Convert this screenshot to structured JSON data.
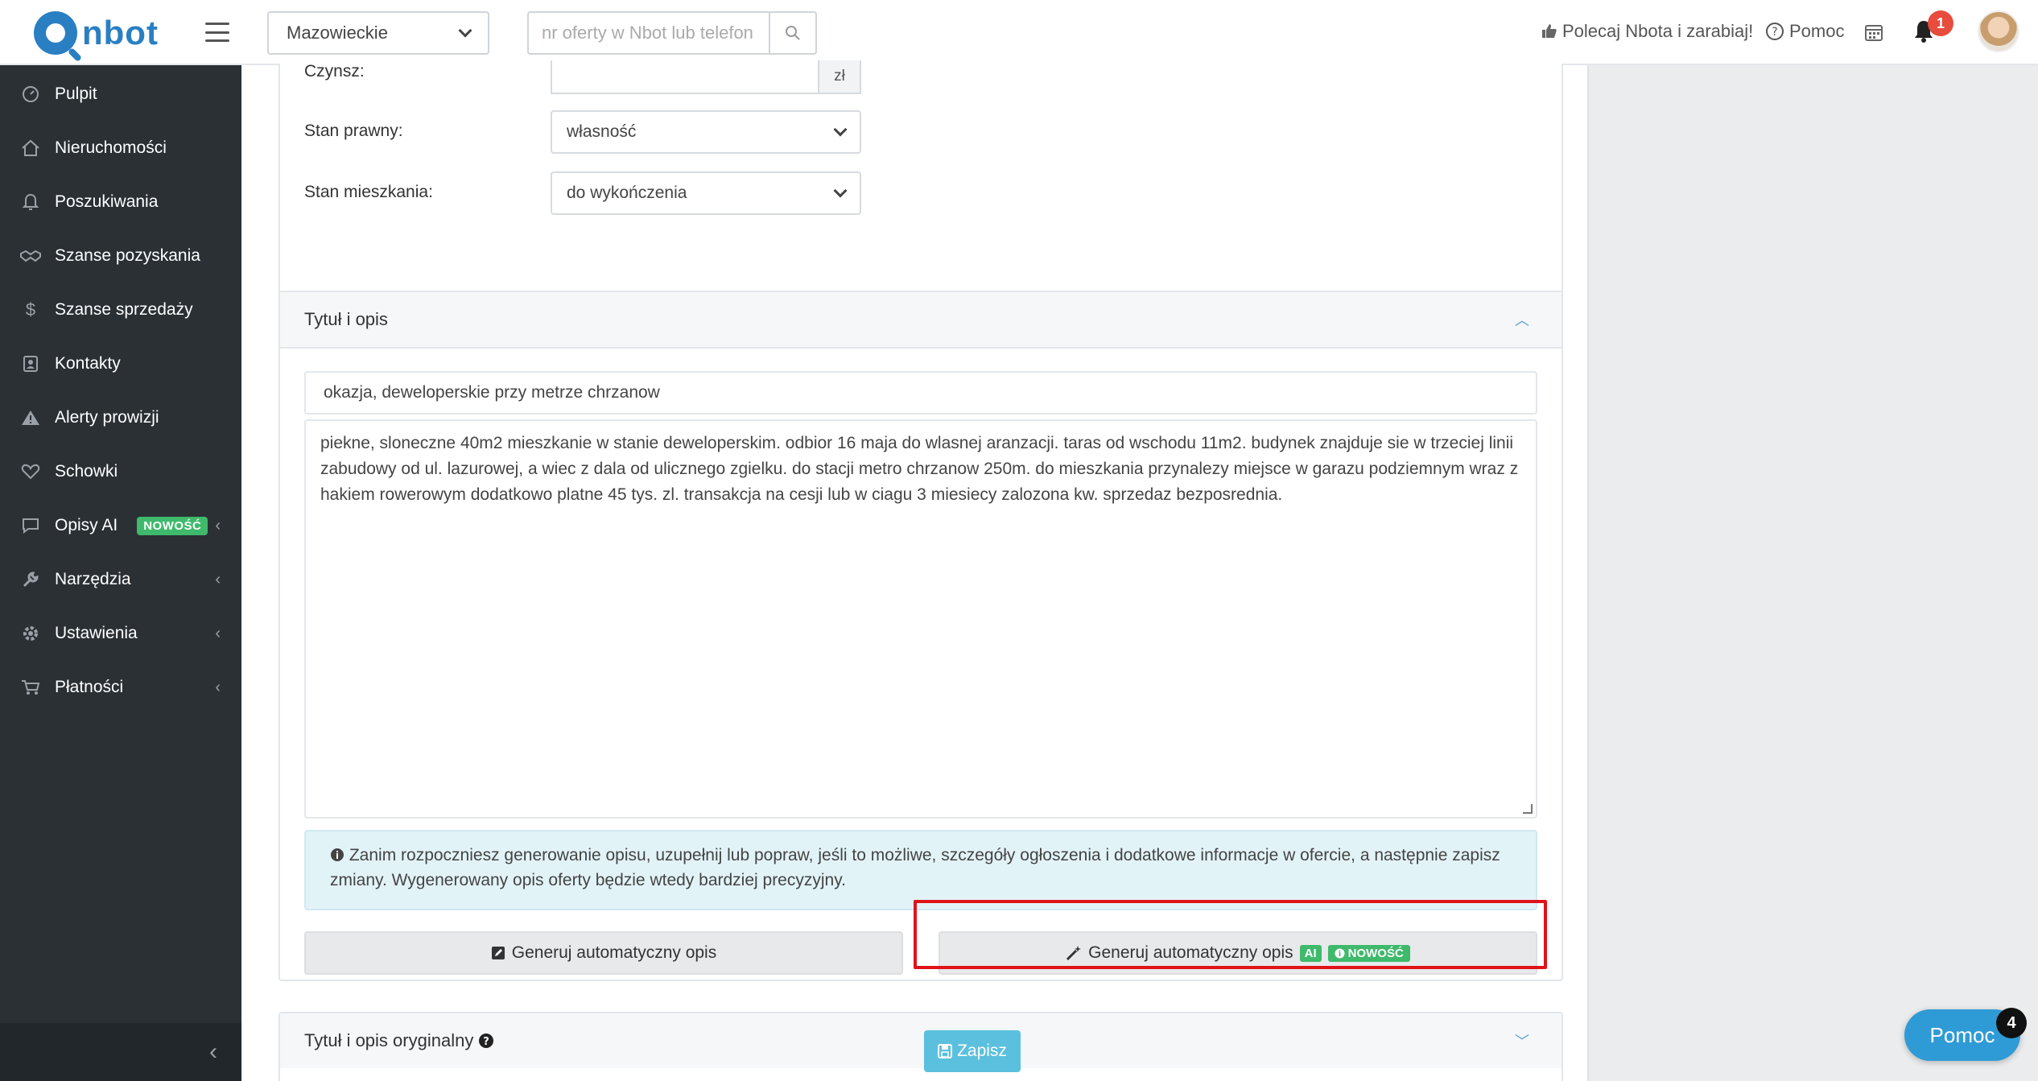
{
  "app": {
    "logo_text": "nbot"
  },
  "navbar": {
    "region": "Mazowieckie",
    "search_placeholder": "nr oferty w Nbot lub telefon",
    "recommend": "Polecaj Nbota i zarabiaj!",
    "help": "Pomoc",
    "notifications_count": "1"
  },
  "sidebar": {
    "items": [
      {
        "label": "Pulpit",
        "icon": "dashboard-icon"
      },
      {
        "label": "Nieruchomości",
        "icon": "home-icon"
      },
      {
        "label": "Poszukiwania",
        "icon": "bell-icon"
      },
      {
        "label": "Szanse pozyskania",
        "icon": "handshake-icon"
      },
      {
        "label": "Szanse sprzedaży",
        "icon": "dollar-icon"
      },
      {
        "label": "Kontakty",
        "icon": "contacts-icon"
      },
      {
        "label": "Alerty prowizji",
        "icon": "warning-icon"
      },
      {
        "label": "Schowki",
        "icon": "heart-icon"
      },
      {
        "label": "Opisy AI",
        "icon": "comment-icon",
        "badge": "NOWOŚĆ",
        "has_caret": true
      },
      {
        "label": "Narzędzia",
        "icon": "wrench-icon",
        "has_caret": true
      },
      {
        "label": "Ustawienia",
        "icon": "gear-icon",
        "has_caret": true
      },
      {
        "label": "Płatności",
        "icon": "cart-icon",
        "has_caret": true
      }
    ]
  },
  "form": {
    "czynsz_label": "Czynsz:",
    "czynsz_unit": "zł",
    "stan_prawny_label": "Stan prawny:",
    "stan_prawny_value": "własność",
    "stan_mieszkania_label": "Stan mieszkania:",
    "stan_mieszkania_value": "do wykończenia"
  },
  "desc_card": {
    "header": "Tytuł i opis",
    "title_value": "okazja, deweloperskie przy metrze chrzanow",
    "description": " piekne, sloneczne 40m2 mieszkanie w stanie deweloperskim. odbior 16 maja do wlasnej aranzacji. taras od wschodu 11m2. budynek znajduje sie w trzeciej linii zabudowy od ul. lazurowej, a wiec z dala od ulicznego zgielku. do stacji metro chrzanow 250m. do mieszkania przynalezy miejsce w garazu podziemnym wraz z hakiem rowerowym dodatkowo platne 45 tys. zl. transakcja na cesji lub w ciagu 3 miesiecy zalozona kw. sprzedaz bezposrednia.",
    "info": "Zanim rozpoczniesz generowanie opisu, uzupełnij lub popraw, jeśli to możliwe, szczegóły ogłoszenia i dodatkowe informacje w ofercie, a następnie zapisz zmiany. Wygenerowany opis oferty będzie wtedy bardziej precyzyjny.",
    "btn_generate": "Generuj automatyczny opis",
    "btn_generate_ai": "Generuj automatyczny opis",
    "ai_badge": "AI",
    "new_badge": "NOWOŚĆ"
  },
  "orig_card": {
    "header": "Tytuł i opis oryginalny"
  },
  "save_label": "Zapisz",
  "help_float": {
    "label": "Pomoc",
    "count": "4"
  },
  "colors": {
    "accent": "#2a7fc3",
    "sidebar": "#2b3035",
    "green_badge": "#3fb96b",
    "highlight": "#e0131a"
  }
}
